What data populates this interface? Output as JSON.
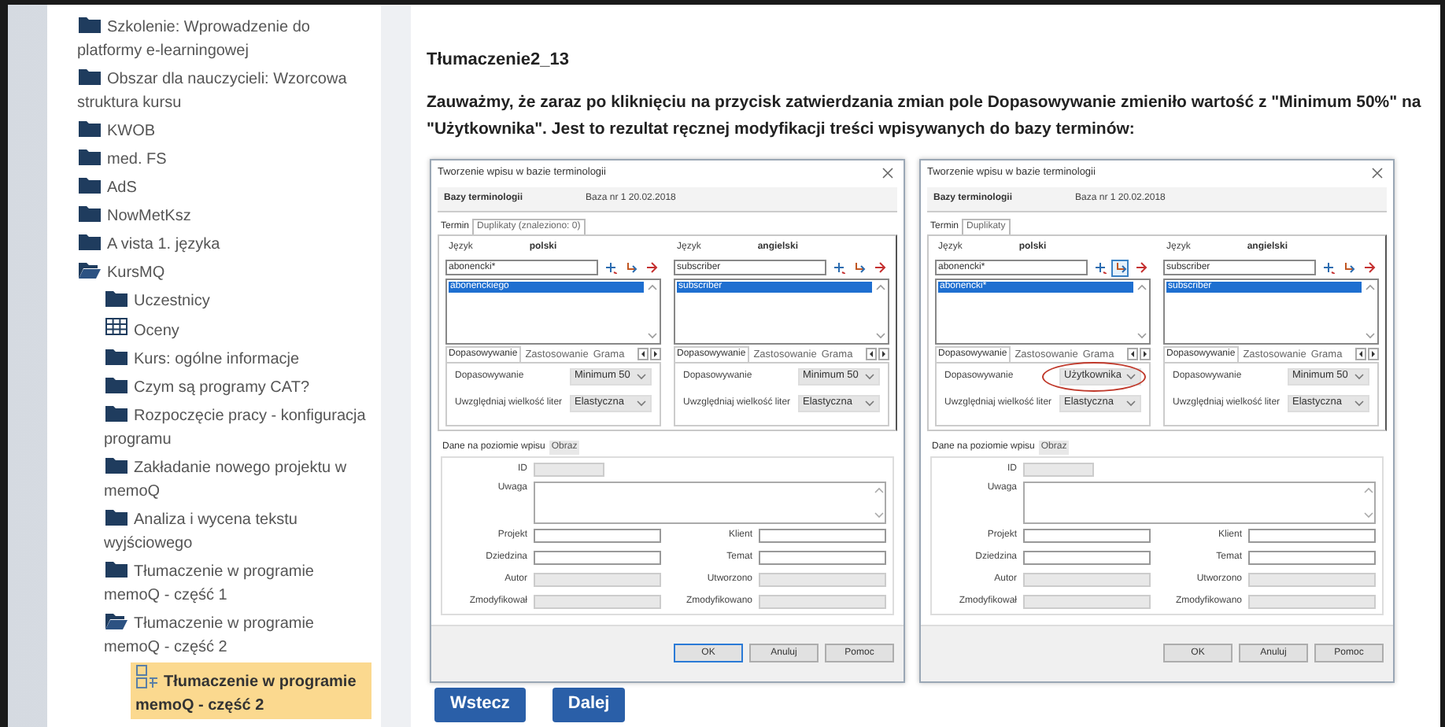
{
  "sidebar": {
    "items": [
      {
        "kind": "folder",
        "label": "Szkolenie: Wprowadzenie do platformy e-learningowej",
        "expanded": false,
        "selected": false
      },
      {
        "kind": "folder",
        "label": "Obszar dla nauczycieli: Wzorcowa struktura kursu",
        "expanded": false,
        "selected": false
      },
      {
        "kind": "folder",
        "label": "KWOB",
        "expanded": false,
        "selected": false
      },
      {
        "kind": "folder",
        "label": "med. FS",
        "expanded": false,
        "selected": false
      },
      {
        "kind": "folder",
        "label": "AdS",
        "expanded": false,
        "selected": false
      },
      {
        "kind": "folder",
        "label": "NowMetKsz",
        "expanded": false,
        "selected": false
      },
      {
        "kind": "folder",
        "label": "A vista 1. języka",
        "expanded": false,
        "selected": false
      },
      {
        "kind": "folder",
        "label": "KursMQ",
        "expanded": true,
        "selected": false,
        "children": [
          {
            "kind": "folder",
            "label": "Uczestnicy",
            "expanded": false,
            "selected": false
          },
          {
            "kind": "grades",
            "label": "Oceny",
            "selected": false
          },
          {
            "kind": "folder",
            "label": "Kurs: ogólne informacje",
            "expanded": false,
            "selected": false
          },
          {
            "kind": "folder",
            "label": "Czym są programy CAT?",
            "expanded": false,
            "selected": false
          },
          {
            "kind": "folder",
            "label": "Rozpoczęcie pracy - konfiguracja programu",
            "expanded": false,
            "selected": false
          },
          {
            "kind": "folder",
            "label": "Zakładanie nowego projektu w memoQ",
            "expanded": false,
            "selected": false
          },
          {
            "kind": "folder",
            "label": "Analiza i wycena tekstu wyjściowego",
            "expanded": false,
            "selected": false
          },
          {
            "kind": "folder",
            "label": "Tłumaczenie w programie memoQ - część 1",
            "expanded": false,
            "selected": false
          },
          {
            "kind": "folder",
            "label": "Tłumaczenie w programie memoQ - część 2",
            "expanded": true,
            "selected": false,
            "children": [
              {
                "kind": "page",
                "label": "Tłumaczenie w programie memoQ - część 2",
                "selected": true
              }
            ]
          }
        ]
      }
    ]
  },
  "content": {
    "title": "Tłumaczenie2_13",
    "paragraph": "Zauważmy, że zaraz po kliknięciu na przycisk zatwierdzania zmian pole Dopasowywanie zmieniło wartość z \"Minimum 50%\" na \"Użytkownika\". Jest to rezultat ręcznej modyfikacji treści wpisywanych do bazy terminów:",
    "dialogs": [
      {
        "title": "Tworzenie wpisu w bazie terminologii",
        "db_label": "Bazy terminologii",
        "db_value": "Baza nr 1 20.02.2018",
        "tabs": [
          {
            "label": "Termin",
            "selected": true
          },
          {
            "label": "Duplikaty (znaleziono: 0)",
            "selected": false
          }
        ],
        "languages": [
          {
            "label": "Język",
            "name": "polski",
            "term": "abonencki*",
            "tools": [
              {
                "pressed": false
              },
              {
                "pressed": false
              },
              {
                "pressed": false
              }
            ],
            "entries": [
              {
                "text": "abonenckiego",
                "selected": true
              }
            ],
            "sub_tabs": [
              {
                "label": "Dopasowywanie",
                "selected": true
              },
              {
                "label": "Zastosowanie",
                "selected": false
              },
              {
                "label": "Grama",
                "selected": false
              }
            ],
            "match_label": "Dopasowywanie",
            "match_value": "Minimum 50",
            "circled": false,
            "case_label": "Uwzględniaj wielkość liter",
            "case_value": "Elastyczna"
          },
          {
            "label": "Język",
            "name": "angielski",
            "term": "subscriber",
            "tools": [
              {
                "pressed": false
              },
              {
                "pressed": false
              },
              {
                "pressed": false
              }
            ],
            "entries": [
              {
                "text": "subscriber",
                "selected": true
              }
            ],
            "sub_tabs": [
              {
                "label": "Dopasowywanie",
                "selected": true
              },
              {
                "label": "Zastosowanie",
                "selected": false
              },
              {
                "label": "Grama",
                "selected": false
              }
            ],
            "match_label": "Dopasowywanie",
            "match_value": "Minimum 50",
            "circled": false,
            "case_label": "Uwzględniaj wielkość liter",
            "case_value": "Elastyczna"
          }
        ],
        "entry_tabs": [
          {
            "label": "Dane na poziomie wpisu",
            "selected": true
          },
          {
            "label": "Obraz",
            "selected": false
          }
        ],
        "id_label": "ID",
        "note_label": "Uwaga",
        "fields": [
          {
            "label": "Projekt",
            "disabled": false
          },
          {
            "label": "Klient",
            "disabled": false
          },
          {
            "label": "Dziedzina",
            "disabled": false
          },
          {
            "label": "Temat",
            "disabled": false
          },
          {
            "label": "Autor",
            "disabled": true
          },
          {
            "label": "Utworzono",
            "disabled": true
          },
          {
            "label": "Zmodyfikował",
            "disabled": true
          },
          {
            "label": "Zmodyfikowano",
            "disabled": true
          }
        ],
        "buttons": [
          {
            "label": "OK",
            "focused": true
          },
          {
            "label": "Anuluj",
            "focused": false
          },
          {
            "label": "Pomoc",
            "focused": false
          }
        ]
      },
      {
        "title": "Tworzenie wpisu w bazie terminologii",
        "db_label": "Bazy terminologii",
        "db_value": "Baza nr 1 20.02.2018",
        "tabs": [
          {
            "label": "Termin",
            "selected": true
          },
          {
            "label": "Duplikaty",
            "selected": false
          }
        ],
        "languages": [
          {
            "label": "Język",
            "name": "polski",
            "term": "abonencki*",
            "tools": [
              {
                "pressed": false
              },
              {
                "pressed": true
              },
              {
                "pressed": false
              }
            ],
            "entries": [
              {
                "text": "abonencki*",
                "selected": true
              }
            ],
            "sub_tabs": [
              {
                "label": "Dopasowywanie",
                "selected": true
              },
              {
                "label": "Zastosowanie",
                "selected": false
              },
              {
                "label": "Grama",
                "selected": false
              }
            ],
            "match_label": "Dopasowywanie",
            "match_value": "Użytkownika",
            "circled": true,
            "case_label": "Uwzględniaj wielkość liter",
            "case_value": "Elastyczna"
          },
          {
            "label": "Język",
            "name": "angielski",
            "term": "subscriber",
            "tools": [
              {
                "pressed": false
              },
              {
                "pressed": false
              },
              {
                "pressed": false
              }
            ],
            "entries": [
              {
                "text": "subscriber",
                "selected": true
              }
            ],
            "sub_tabs": [
              {
                "label": "Dopasowywanie",
                "selected": true
              },
              {
                "label": "Zastosowanie",
                "selected": false
              },
              {
                "label": "Grama",
                "selected": false
              }
            ],
            "match_label": "Dopasowywanie",
            "match_value": "Minimum 50",
            "circled": false,
            "case_label": "Uwzględniaj wielkość liter",
            "case_value": "Elastyczna"
          }
        ],
        "entry_tabs": [
          {
            "label": "Dane na poziomie wpisu",
            "selected": true
          },
          {
            "label": "Obraz",
            "selected": false
          }
        ],
        "id_label": "ID",
        "note_label": "Uwaga",
        "fields": [
          {
            "label": "Projekt",
            "disabled": false
          },
          {
            "label": "Klient",
            "disabled": false
          },
          {
            "label": "Dziedzina",
            "disabled": false
          },
          {
            "label": "Temat",
            "disabled": false
          },
          {
            "label": "Autor",
            "disabled": true
          },
          {
            "label": "Utworzono",
            "disabled": true
          },
          {
            "label": "Zmodyfikował",
            "disabled": true
          },
          {
            "label": "Zmodyfikowano",
            "disabled": true
          }
        ],
        "buttons": [
          {
            "label": "OK",
            "focused": false
          },
          {
            "label": "Anuluj",
            "focused": false
          },
          {
            "label": "Pomoc",
            "focused": false
          }
        ]
      }
    ],
    "buttons": [
      {
        "label": "Wstecz"
      },
      {
        "label": "Dalej"
      }
    ]
  }
}
